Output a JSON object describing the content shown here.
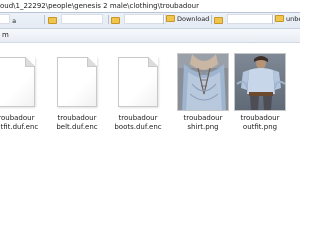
{
  "address_bar": {
    "path": "oud\\1_22292\\people\\genesis 2 male\\clothing\\troubadour"
  },
  "favorites": {
    "item1": "a",
    "item2": "Download",
    "item3": "unbek"
  },
  "command_bar": {
    "label": "m"
  },
  "files": [
    {
      "name": "troubadour outfit.duf.enc",
      "line1": "troubadour",
      "line2": "outfit.duf.enc",
      "type": "document"
    },
    {
      "name": "troubadour belt.duf.enc",
      "line1": "troubadour",
      "line2": "belt.duf.enc",
      "type": "document"
    },
    {
      "name": "troubadour boots.duf.enc",
      "line1": "troubadour",
      "line2": "boots.duf.enc",
      "type": "document"
    },
    {
      "name": "troubadour shirt.png",
      "line1": "troubadour shirt.png",
      "line2": "",
      "type": "image-shirt"
    },
    {
      "name": "troubadour outfit.png",
      "line1": "troubadour",
      "line2": "outfit.png",
      "type": "image-outfit"
    }
  ]
}
